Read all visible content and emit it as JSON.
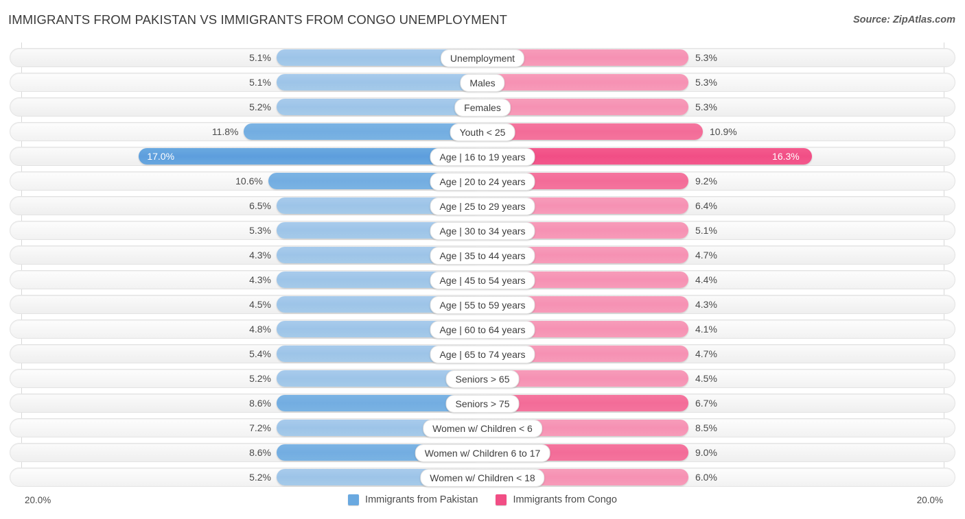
{
  "header": {
    "title": "IMMIGRANTS FROM PAKISTAN VS IMMIGRANTS FROM CONGO UNEMPLOYMENT",
    "source": "Source: ZipAtlas.com"
  },
  "axis": {
    "left_label": "20.0%",
    "right_label": "20.0%",
    "max": 20.0
  },
  "legend": {
    "items": [
      {
        "label": "Immigrants from Pakistan",
        "color": "#6aa9e0",
        "icon": "legend-swatch-blue"
      },
      {
        "label": "Immigrants from Congo",
        "color": "#f14e85",
        "icon": "legend-swatch-pink"
      }
    ]
  },
  "colors": {
    "left_bar": "#9dc4e8",
    "right_bar": "#f691b3",
    "left_bar_strong": "#5d9edd",
    "right_bar_strong": "#f14e85",
    "track": "#f4f4f4",
    "gridline": "#d8d8d8"
  },
  "chart_data": {
    "type": "bar",
    "title": "IMMIGRANTS FROM PAKISTAN VS IMMIGRANTS FROM CONGO UNEMPLOYMENT",
    "subtitle": "",
    "orientation": "horizontal-diverging",
    "xlabel": "",
    "ylabel": "",
    "xlim": [
      -20.0,
      20.0
    ],
    "grid": true,
    "legend_position": "bottom-center",
    "categories": [
      "Unemployment",
      "Males",
      "Females",
      "Youth < 25",
      "Age | 16 to 19 years",
      "Age | 20 to 24 years",
      "Age | 25 to 29 years",
      "Age | 30 to 34 years",
      "Age | 35 to 44 years",
      "Age | 45 to 54 years",
      "Age | 55 to 59 years",
      "Age | 60 to 64 years",
      "Age | 65 to 74 years",
      "Seniors > 65",
      "Seniors > 75",
      "Women w/ Children < 6",
      "Women w/ Children 6 to 17",
      "Women w/ Children < 18"
    ],
    "series": [
      {
        "name": "Immigrants from Pakistan",
        "values": [
          5.1,
          5.1,
          5.2,
          11.8,
          17.0,
          10.6,
          6.5,
          5.3,
          4.3,
          4.3,
          4.5,
          4.8,
          5.4,
          5.2,
          8.6,
          7.2,
          8.6,
          5.2
        ],
        "labels": [
          "5.1%",
          "5.1%",
          "5.2%",
          "11.8%",
          "17.0%",
          "10.6%",
          "6.5%",
          "5.3%",
          "4.3%",
          "4.3%",
          "4.5%",
          "4.8%",
          "5.4%",
          "5.2%",
          "8.6%",
          "7.2%",
          "8.6%",
          "5.2%"
        ]
      },
      {
        "name": "Immigrants from Congo",
        "values": [
          5.3,
          5.3,
          5.3,
          10.9,
          16.3,
          9.2,
          6.4,
          5.1,
          4.7,
          4.4,
          4.3,
          4.1,
          4.7,
          4.5,
          6.7,
          8.5,
          9.0,
          6.0
        ],
        "labels": [
          "5.3%",
          "5.3%",
          "5.3%",
          "10.9%",
          "16.3%",
          "9.2%",
          "6.4%",
          "5.1%",
          "4.7%",
          "4.4%",
          "4.3%",
          "4.1%",
          "4.7%",
          "4.5%",
          "6.7%",
          "8.5%",
          "9.0%",
          "6.0%"
        ]
      }
    ]
  },
  "rows": [
    {
      "label": "Unemployment",
      "left": "5.1%",
      "right": "5.3%",
      "lv": 5.1,
      "rv": 5.3,
      "style": "base"
    },
    {
      "label": "Males",
      "left": "5.1%",
      "right": "5.3%",
      "lv": 5.1,
      "rv": 5.3,
      "style": "base"
    },
    {
      "label": "Females",
      "left": "5.2%",
      "right": "5.3%",
      "lv": 5.2,
      "rv": 5.3,
      "style": "base"
    },
    {
      "label": "Youth < 25",
      "left": "11.8%",
      "right": "10.9%",
      "lv": 11.8,
      "rv": 10.9,
      "style": "mid"
    },
    {
      "label": "Age | 16 to 19 years",
      "left": "17.0%",
      "right": "16.3%",
      "lv": 17.0,
      "rv": 16.3,
      "style": "hi"
    },
    {
      "label": "Age | 20 to 24 years",
      "left": "10.6%",
      "right": "9.2%",
      "lv": 10.6,
      "rv": 9.2,
      "style": "mid"
    },
    {
      "label": "Age | 25 to 29 years",
      "left": "6.5%",
      "right": "6.4%",
      "lv": 6.5,
      "rv": 6.4,
      "style": "base"
    },
    {
      "label": "Age | 30 to 34 years",
      "left": "5.3%",
      "right": "5.1%",
      "lv": 5.3,
      "rv": 5.1,
      "style": "base"
    },
    {
      "label": "Age | 35 to 44 years",
      "left": "4.3%",
      "right": "4.7%",
      "lv": 4.3,
      "rv": 4.7,
      "style": "base"
    },
    {
      "label": "Age | 45 to 54 years",
      "left": "4.3%",
      "right": "4.4%",
      "lv": 4.3,
      "rv": 4.4,
      "style": "base"
    },
    {
      "label": "Age | 55 to 59 years",
      "left": "4.5%",
      "right": "4.3%",
      "lv": 4.5,
      "rv": 4.3,
      "style": "base"
    },
    {
      "label": "Age | 60 to 64 years",
      "left": "4.8%",
      "right": "4.1%",
      "lv": 4.8,
      "rv": 4.1,
      "style": "base"
    },
    {
      "label": "Age | 65 to 74 years",
      "left": "5.4%",
      "right": "4.7%",
      "lv": 5.4,
      "rv": 4.7,
      "style": "base"
    },
    {
      "label": "Seniors > 65",
      "left": "5.2%",
      "right": "4.5%",
      "lv": 5.2,
      "rv": 4.5,
      "style": "base"
    },
    {
      "label": "Seniors > 75",
      "left": "8.6%",
      "right": "6.7%",
      "lv": 8.6,
      "rv": 6.7,
      "style": "mid"
    },
    {
      "label": "Women w/ Children < 6",
      "left": "7.2%",
      "right": "8.5%",
      "lv": 7.2,
      "rv": 8.5,
      "style": "base"
    },
    {
      "label": "Women w/ Children 6 to 17",
      "left": "8.6%",
      "right": "9.0%",
      "lv": 8.6,
      "rv": 9.0,
      "style": "mid"
    },
    {
      "label": "Women w/ Children < 18",
      "left": "5.2%",
      "right": "6.0%",
      "lv": 5.2,
      "rv": 6.0,
      "style": "base"
    }
  ]
}
